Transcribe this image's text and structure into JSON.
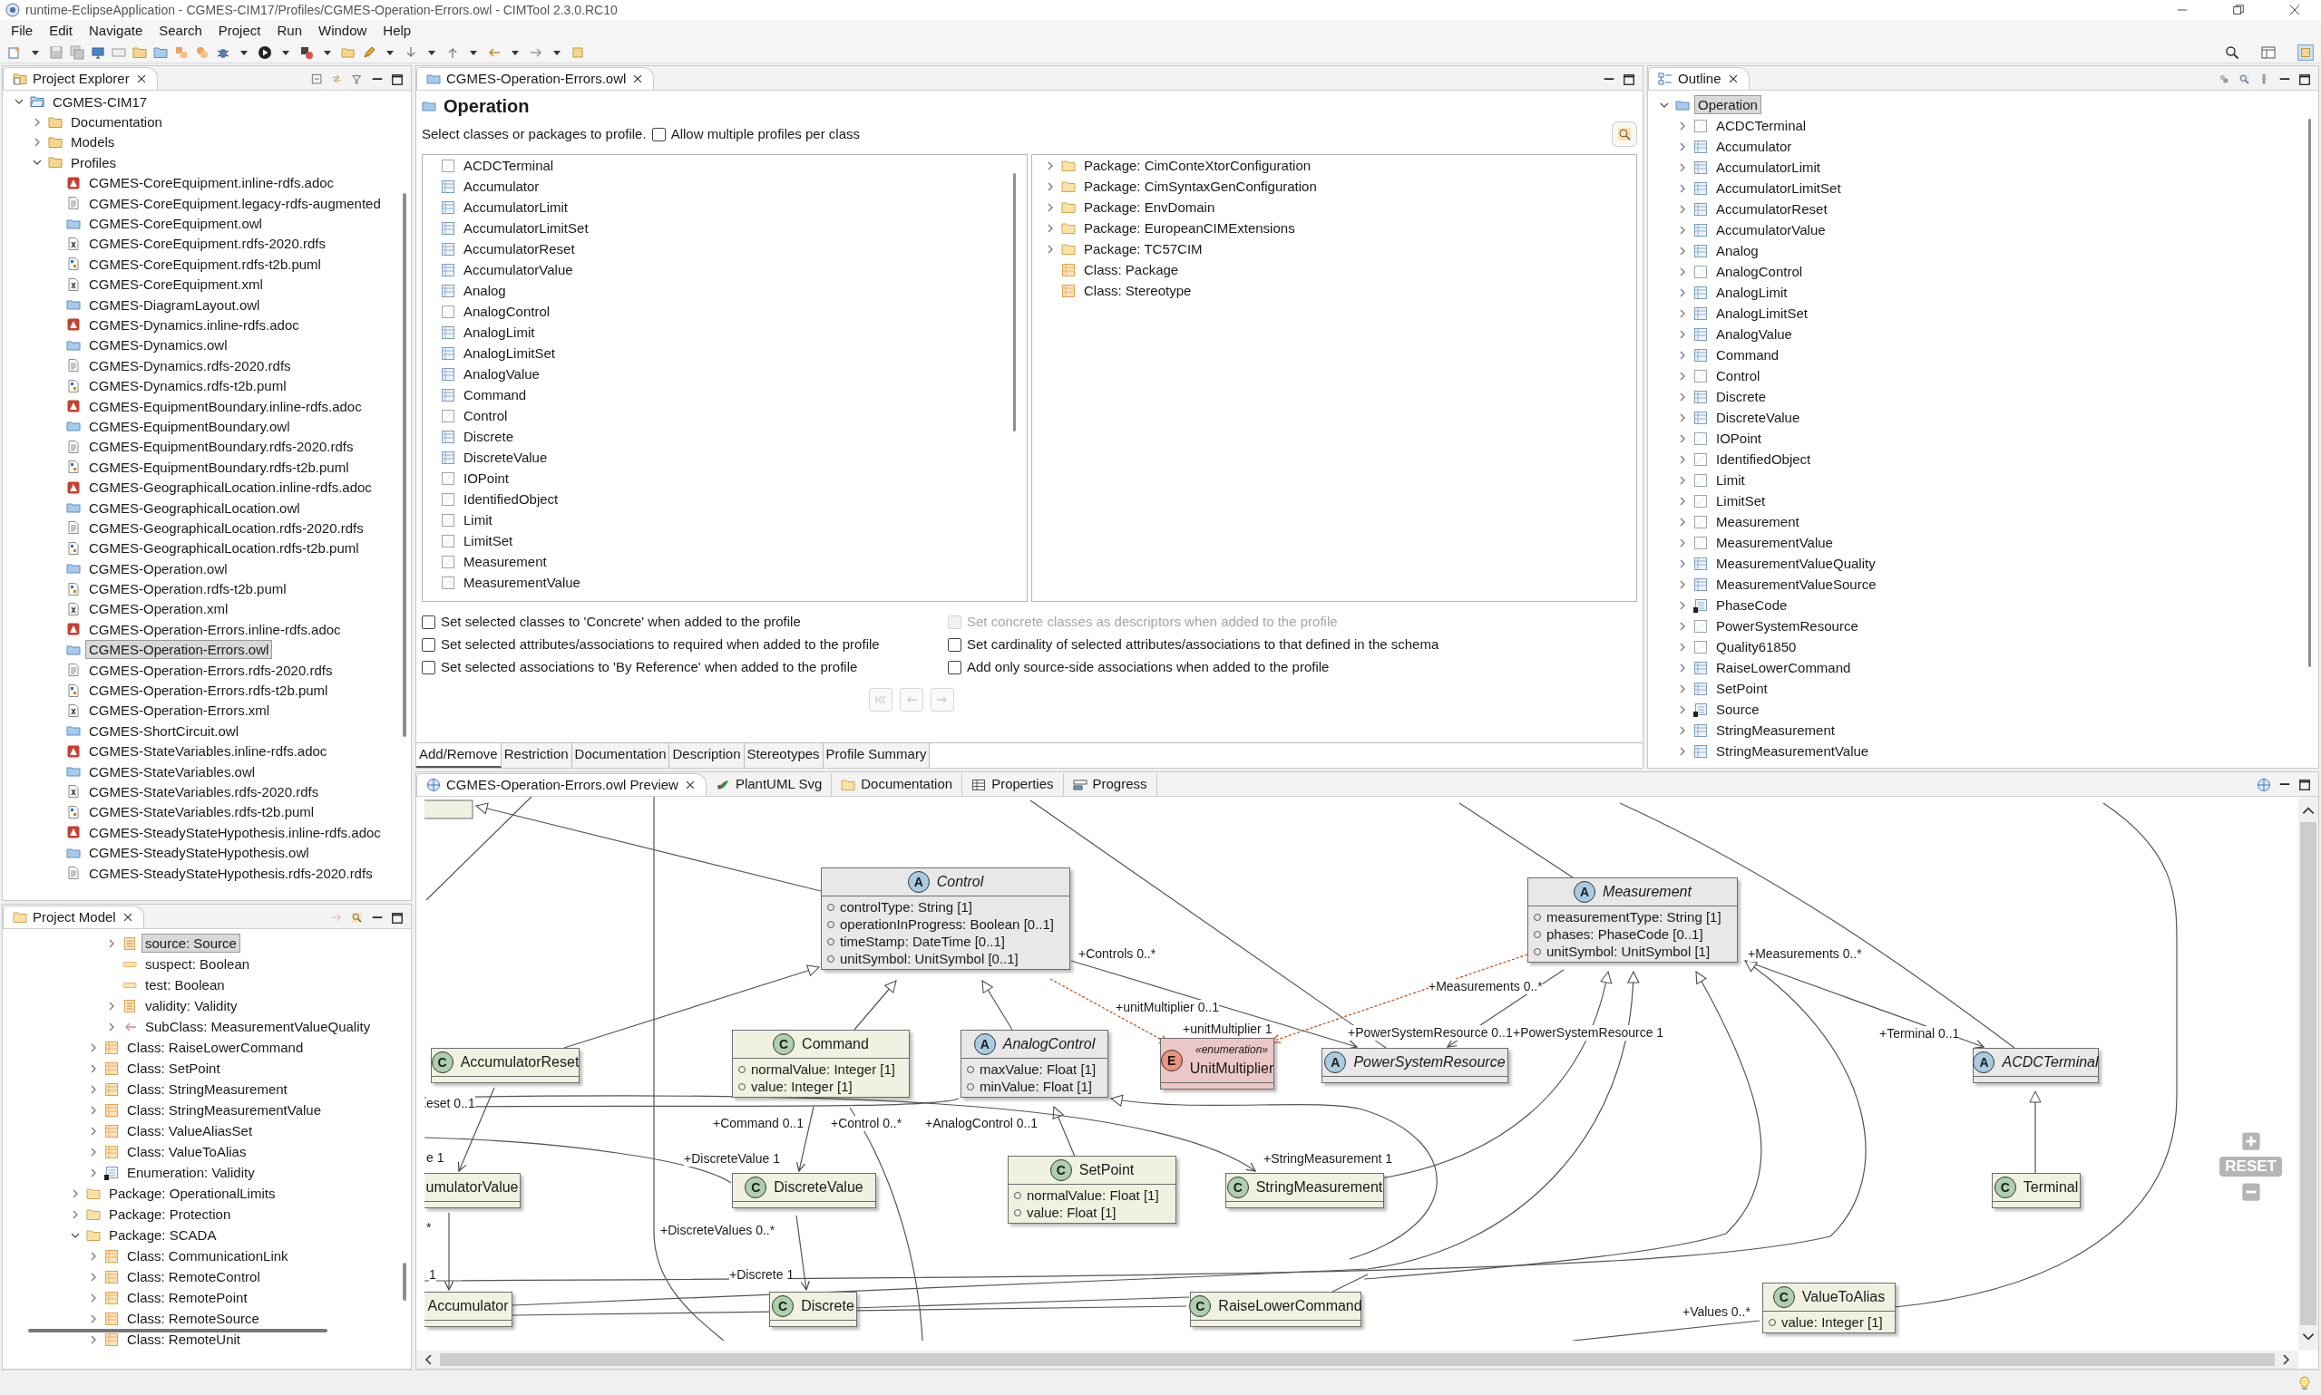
{
  "window": {
    "title": "runtime-EclipseApplication - CGMES-CIM17/Profiles/CGMES-Operation-Errors.owl - CIMTool 2.3.0.RC10"
  },
  "menu": [
    "File",
    "Edit",
    "Navigate",
    "Search",
    "Project",
    "Run",
    "Window",
    "Help"
  ],
  "project_explorer": {
    "title": "Project Explorer",
    "tree": [
      {
        "label": "CGMES-CIM17",
        "kind": "project",
        "expanded": true,
        "selected": false,
        "children": [
          {
            "label": "Documentation",
            "kind": "folder",
            "expanded": false,
            "selected": false
          },
          {
            "label": "Models",
            "kind": "folder",
            "expanded": false,
            "selected": false
          },
          {
            "label": "Profiles",
            "kind": "folder",
            "expanded": true,
            "selected": false,
            "children": [
              {
                "label": "CGMES-CoreEquipment.inline-rdfs.adoc",
                "kind": "adoc",
                "selected": false
              },
              {
                "label": "CGMES-CoreEquipment.legacy-rdfs-augmented",
                "kind": "text",
                "selected": false
              },
              {
                "label": "CGMES-CoreEquipment.owl",
                "kind": "owl",
                "selected": false
              },
              {
                "label": "CGMES-CoreEquipment.rdfs-2020.rdfs",
                "kind": "xml",
                "selected": false
              },
              {
                "label": "CGMES-CoreEquipment.rdfs-t2b.puml",
                "kind": "puml",
                "selected": false
              },
              {
                "label": "CGMES-CoreEquipment.xml",
                "kind": "xml",
                "selected": false
              },
              {
                "label": "CGMES-DiagramLayout.owl",
                "kind": "owl",
                "selected": false
              },
              {
                "label": "CGMES-Dynamics.inline-rdfs.adoc",
                "kind": "adoc",
                "selected": false
              },
              {
                "label": "CGMES-Dynamics.owl",
                "kind": "owl",
                "selected": false
              },
              {
                "label": "CGMES-Dynamics.rdfs-2020.rdfs",
                "kind": "text",
                "selected": false
              },
              {
                "label": "CGMES-Dynamics.rdfs-t2b.puml",
                "kind": "puml",
                "selected": false
              },
              {
                "label": "CGMES-EquipmentBoundary.inline-rdfs.adoc",
                "kind": "adoc",
                "selected": false
              },
              {
                "label": "CGMES-EquipmentBoundary.owl",
                "kind": "owl",
                "selected": false
              },
              {
                "label": "CGMES-EquipmentBoundary.rdfs-2020.rdfs",
                "kind": "text",
                "selected": false
              },
              {
                "label": "CGMES-EquipmentBoundary.rdfs-t2b.puml",
                "kind": "puml",
                "selected": false
              },
              {
                "label": "CGMES-GeographicalLocation.inline-rdfs.adoc",
                "kind": "adoc",
                "selected": false
              },
              {
                "label": "CGMES-GeographicalLocation.owl",
                "kind": "owl",
                "selected": false
              },
              {
                "label": "CGMES-GeographicalLocation.rdfs-2020.rdfs",
                "kind": "text",
                "selected": false
              },
              {
                "label": "CGMES-GeographicalLocation.rdfs-t2b.puml",
                "kind": "puml",
                "selected": false
              },
              {
                "label": "CGMES-Operation.owl",
                "kind": "owl",
                "selected": false
              },
              {
                "label": "CGMES-Operation.rdfs-t2b.puml",
                "kind": "puml",
                "selected": false
              },
              {
                "label": "CGMES-Operation.xml",
                "kind": "xml",
                "selected": false
              },
              {
                "label": "CGMES-Operation-Errors.inline-rdfs.adoc",
                "kind": "adoc",
                "selected": false
              },
              {
                "label": "CGMES-Operation-Errors.owl",
                "kind": "owl",
                "selected": true
              },
              {
                "label": "CGMES-Operation-Errors.rdfs-2020.rdfs",
                "kind": "text",
                "selected": false
              },
              {
                "label": "CGMES-Operation-Errors.rdfs-t2b.puml",
                "kind": "puml",
                "selected": false
              },
              {
                "label": "CGMES-Operation-Errors.xml",
                "kind": "xml",
                "selected": false
              },
              {
                "label": "CGMES-ShortCircuit.owl",
                "kind": "owl",
                "selected": false
              },
              {
                "label": "CGMES-StateVariables.inline-rdfs.adoc",
                "kind": "adoc",
                "selected": false
              },
              {
                "label": "CGMES-StateVariables.owl",
                "kind": "owl",
                "selected": false
              },
              {
                "label": "CGMES-StateVariables.rdfs-2020.rdfs",
                "kind": "xml",
                "selected": false
              },
              {
                "label": "CGMES-StateVariables.rdfs-t2b.puml",
                "kind": "puml",
                "selected": false
              },
              {
                "label": "CGMES-SteadyStateHypothesis.inline-rdfs.adoc",
                "kind": "adoc",
                "selected": false
              },
              {
                "label": "CGMES-SteadyStateHypothesis.owl",
                "kind": "owl",
                "selected": false
              },
              {
                "label": "CGMES-SteadyStateHypothesis.rdfs-2020.rdfs",
                "kind": "text",
                "selected": false
              }
            ]
          }
        ]
      }
    ]
  },
  "project_model": {
    "title": "Project Model",
    "tree": [
      {
        "children": [
          {
            "children": [
              {
                "label": "source: Source",
                "kind": "attribute-class",
                "expanded": false,
                "selected": true
              },
              {
                "label": "suspect: Boolean",
                "kind": "attribute",
                "selected": false
              },
              {
                "label": "test: Boolean",
                "kind": "attribute",
                "selected": false
              },
              {
                "label": "validity: Validity",
                "kind": "attribute-class",
                "expanded": false,
                "selected": false
              },
              {
                "label": "SubClass: MeasurementValueQuality",
                "kind": "subclass",
                "expanded": false,
                "selected": false
              }
            ]
          },
          {
            "label": "Class: RaiseLowerCommand",
            "kind": "class",
            "expanded": false,
            "selected": false
          },
          {
            "label": "Class: SetPoint",
            "kind": "class",
            "expanded": false,
            "selected": false
          },
          {
            "label": "Class: StringMeasurement",
            "kind": "class",
            "expanded": false,
            "selected": false
          },
          {
            "label": "Class: StringMeasurementValue",
            "kind": "class",
            "expanded": false,
            "selected": false
          },
          {
            "label": "Class: ValueAliasSet",
            "kind": "class",
            "expanded": false,
            "selected": false
          },
          {
            "label": "Class: ValueToAlias",
            "kind": "class",
            "expanded": false,
            "selected": false
          },
          {
            "label": "Enumeration: Validity",
            "kind": "enumeration",
            "expanded": false,
            "selected": false
          }
        ]
      },
      {
        "label": "Package: OperationalLimits",
        "kind": "package",
        "expanded": false,
        "selected": false
      },
      {
        "label": "Package: Protection",
        "kind": "package",
        "expanded": false,
        "selected": false
      },
      {
        "label": "Package: SCADA",
        "kind": "package",
        "expanded": true,
        "selected": false,
        "children": [
          {
            "label": "Class: CommunicationLink",
            "kind": "class",
            "expanded": false,
            "selected": false
          },
          {
            "label": "Class: RemoteControl",
            "kind": "class",
            "expanded": false,
            "selected": false
          },
          {
            "label": "Class: RemotePoint",
            "kind": "class",
            "expanded": false,
            "selected": false
          },
          {
            "label": "Class: RemoteSource",
            "kind": "class",
            "expanded": false,
            "selected": false
          },
          {
            "label": "Class: RemoteUnit",
            "kind": "class",
            "expanded": false,
            "selected": false
          }
        ]
      }
    ]
  },
  "editor": {
    "tab": {
      "label": "CGMES-Operation-Errors.owl",
      "selected": true
    },
    "heading": "Operation",
    "instruction": "Select classes or packages to profile.",
    "allow_multiple": {
      "label": "Allow multiple profiles per class",
      "checked": false
    },
    "classes": [
      {
        "label": "ACDCTerminal",
        "kind": "abstract"
      },
      {
        "label": "Accumulator",
        "kind": "concrete"
      },
      {
        "label": "AccumulatorLimit",
        "kind": "concrete"
      },
      {
        "label": "AccumulatorLimitSet",
        "kind": "concrete"
      },
      {
        "label": "AccumulatorReset",
        "kind": "concrete"
      },
      {
        "label": "AccumulatorValue",
        "kind": "concrete"
      },
      {
        "label": "Analog",
        "kind": "concrete"
      },
      {
        "label": "AnalogControl",
        "kind": "abstract"
      },
      {
        "label": "AnalogLimit",
        "kind": "concrete"
      },
      {
        "label": "AnalogLimitSet",
        "kind": "concrete"
      },
      {
        "label": "AnalogValue",
        "kind": "concrete"
      },
      {
        "label": "Command",
        "kind": "concrete"
      },
      {
        "label": "Control",
        "kind": "abstract"
      },
      {
        "label": "Discrete",
        "kind": "concrete"
      },
      {
        "label": "DiscreteValue",
        "kind": "concrete"
      },
      {
        "label": "IOPoint",
        "kind": "abstract"
      },
      {
        "label": "IdentifiedObject",
        "kind": "abstract"
      },
      {
        "label": "Limit",
        "kind": "abstract"
      },
      {
        "label": "LimitSet",
        "kind": "abstract"
      },
      {
        "label": "Measurement",
        "kind": "abstract"
      },
      {
        "label": "MeasurementValue",
        "kind": "abstract"
      }
    ],
    "schema": [
      {
        "label": "Package: CimConteXtorConfiguration",
        "kind": "package",
        "expanded": false
      },
      {
        "label": "Package: CimSyntaxGenConfiguration",
        "kind": "package",
        "expanded": false
      },
      {
        "label": "Package: EnvDomain",
        "kind": "package",
        "expanded": false
      },
      {
        "label": "Package: EuropeanCIMExtensions",
        "kind": "package",
        "expanded": false
      },
      {
        "label": "Package: TC57CIM",
        "kind": "package",
        "expanded": false
      },
      {
        "label": "Class: Package",
        "kind": "class"
      },
      {
        "label": "Class: Stereotype",
        "kind": "class"
      }
    ],
    "options": [
      {
        "label": "Set selected classes to 'Concrete' when added to the profile",
        "checked": false,
        "disabled": false
      },
      {
        "label": "Set selected attributes/associations to required when added to the profile",
        "checked": false,
        "disabled": false
      },
      {
        "label": "Set selected associations to 'By Reference' when added to the profile",
        "checked": false,
        "disabled": false
      },
      {
        "label": "Set concrete classes as descriptors when added to the profile",
        "checked": false,
        "disabled": true
      },
      {
        "label": "Set cardinality of selected attributes/associations to that defined in the schema",
        "checked": false,
        "disabled": false
      },
      {
        "label": "Add only source-side associations when added to the profile",
        "checked": false,
        "disabled": false
      }
    ],
    "bottom_tabs": [
      {
        "label": "Add/Remove",
        "selected": true
      },
      {
        "label": "Restriction",
        "selected": false
      },
      {
        "label": "Documentation",
        "selected": false
      },
      {
        "label": "Description",
        "selected": false
      },
      {
        "label": "Stereotypes",
        "selected": false
      },
      {
        "label": "Profile Summary",
        "selected": false
      }
    ]
  },
  "outline": {
    "title": "Outline",
    "root": {
      "label": "Operation",
      "expanded": true,
      "selected": true,
      "children": [
        {
          "label": "ACDCTerminal",
          "kind": "abstract",
          "expanded": false,
          "selected": false
        },
        {
          "label": "Accumulator",
          "kind": "concrete",
          "expanded": false,
          "selected": false
        },
        {
          "label": "AccumulatorLimit",
          "kind": "concrete",
          "expanded": false,
          "selected": false
        },
        {
          "label": "AccumulatorLimitSet",
          "kind": "concrete",
          "expanded": false,
          "selected": false
        },
        {
          "label": "AccumulatorReset",
          "kind": "concrete",
          "expanded": false,
          "selected": false
        },
        {
          "label": "AccumulatorValue",
          "kind": "concrete",
          "expanded": false,
          "selected": false
        },
        {
          "label": "Analog",
          "kind": "concrete",
          "expanded": false,
          "selected": false
        },
        {
          "label": "AnalogControl",
          "kind": "abstract",
          "expanded": false,
          "selected": false
        },
        {
          "label": "AnalogLimit",
          "kind": "concrete",
          "expanded": false,
          "selected": false
        },
        {
          "label": "AnalogLimitSet",
          "kind": "concrete",
          "expanded": false,
          "selected": false
        },
        {
          "label": "AnalogValue",
          "kind": "concrete",
          "expanded": false,
          "selected": false
        },
        {
          "label": "Command",
          "kind": "concrete",
          "expanded": false,
          "selected": false
        },
        {
          "label": "Control",
          "kind": "abstract",
          "expanded": false,
          "selected": false
        },
        {
          "label": "Discrete",
          "kind": "concrete",
          "expanded": false,
          "selected": false
        },
        {
          "label": "DiscreteValue",
          "kind": "concrete",
          "expanded": false,
          "selected": false
        },
        {
          "label": "IOPoint",
          "kind": "abstract",
          "expanded": false,
          "selected": false
        },
        {
          "label": "IdentifiedObject",
          "kind": "abstract",
          "expanded": false,
          "selected": false
        },
        {
          "label": "Limit",
          "kind": "abstract",
          "expanded": false,
          "selected": false
        },
        {
          "label": "LimitSet",
          "kind": "abstract",
          "expanded": false,
          "selected": false
        },
        {
          "label": "Measurement",
          "kind": "abstract",
          "expanded": false,
          "selected": false
        },
        {
          "label": "MeasurementValue",
          "kind": "abstract",
          "expanded": false,
          "selected": false
        },
        {
          "label": "MeasurementValueQuality",
          "kind": "concrete",
          "expanded": false,
          "selected": false
        },
        {
          "label": "MeasurementValueSource",
          "kind": "concrete",
          "expanded": false,
          "selected": false
        },
        {
          "label": "PhaseCode",
          "kind": "enumeration",
          "expanded": false,
          "selected": false
        },
        {
          "label": "PowerSystemResource",
          "kind": "abstract",
          "expanded": false,
          "selected": false
        },
        {
          "label": "Quality61850",
          "kind": "abstract",
          "expanded": false,
          "selected": false
        },
        {
          "label": "RaiseLowerCommand",
          "kind": "concrete",
          "expanded": false,
          "selected": false
        },
        {
          "label": "SetPoint",
          "kind": "concrete",
          "expanded": false,
          "selected": false
        },
        {
          "label": "Source",
          "kind": "enumeration",
          "expanded": false,
          "selected": false
        },
        {
          "label": "StringMeasurement",
          "kind": "concrete",
          "expanded": false,
          "selected": false
        },
        {
          "label": "StringMeasurementValue",
          "kind": "concrete",
          "expanded": false,
          "selected": false
        }
      ]
    }
  },
  "preview": {
    "tabs": [
      {
        "label": "CGMES-Operation-Errors.owl Preview",
        "selected": true
      },
      {
        "label": "PlantUML Svg",
        "selected": false
      },
      {
        "label": "Documentation",
        "selected": false
      },
      {
        "label": "Properties",
        "selected": false
      },
      {
        "label": "Progress",
        "selected": false
      }
    ],
    "zoom_reset": "RESET",
    "nodes": [
      {
        "name": "Control",
        "badge": "A",
        "kind": "abstract",
        "attributes": [
          "controlType: String [1]",
          "operationInProgress: Boolean [0..1]",
          "timeStamp: DateTime [0..1]",
          "unitSymbol: UnitSymbol [0..1]"
        ]
      },
      {
        "name": "Measurement",
        "badge": "A",
        "kind": "abstract",
        "attributes": [
          "measurementType: String [1]",
          "phases: PhaseCode [0..1]",
          "unitSymbol: UnitSymbol [1]"
        ]
      },
      {
        "name": "AccumulatorReset",
        "badge": "C",
        "kind": "class"
      },
      {
        "name": "Command",
        "badge": "C",
        "kind": "class",
        "attributes": [
          "normalValue: Integer [1]",
          "value: Integer [1]"
        ]
      },
      {
        "name": "AnalogControl",
        "badge": "A",
        "kind": "abstract",
        "attributes": [
          "maxValue: Float [1]",
          "minValue: Float [1]"
        ]
      },
      {
        "name": "UnitMultiplier",
        "badge": "E",
        "kind": "enumeration",
        "stereotype": "«enumeration»"
      },
      {
        "name": "PowerSystemResource",
        "badge": "A",
        "kind": "abstract"
      },
      {
        "name": "ACDCTerminal",
        "badge": "A",
        "kind": "abstract"
      },
      {
        "name": "umulatorValue",
        "kind": "class"
      },
      {
        "name": "DiscreteValue",
        "badge": "C",
        "kind": "class"
      },
      {
        "name": "SetPoint",
        "badge": "C",
        "kind": "class",
        "attributes": [
          "normalValue: Float [1]",
          "value: Float [1]"
        ]
      },
      {
        "name": "StringMeasurement",
        "badge": "C",
        "kind": "class"
      },
      {
        "name": "Terminal",
        "badge": "C",
        "kind": "class"
      },
      {
        "name": "Accumulator",
        "kind": "class"
      },
      {
        "name": "Discrete",
        "badge": "C",
        "kind": "class"
      },
      {
        "name": "RaiseLowerCommand",
        "badge": "C",
        "kind": "class"
      },
      {
        "name": "ValueToAlias",
        "badge": "C",
        "kind": "class",
        "attributes": [
          "value: Integer [1]"
        ]
      }
    ],
    "labels": [
      "+Controls 0..*",
      "+unitMultiplier 0..1",
      "+unitMultiplier 1",
      "+Measurements 0..*",
      "+PowerSystemResource 0..1",
      "+PowerSystemResource 1",
      "+Measurements 0..*",
      "+Terminal 0..1",
      "eset 0..1",
      "e 1",
      "+Command 0..1",
      "+Control 0..*",
      "+AnalogControl 0..1",
      "+DiscreteValue 1",
      "+StringMeasurement 1",
      "+DiscreteValues 0..*",
      "*",
      "+Discrete 1",
      "1",
      "+Values 0..*"
    ]
  }
}
